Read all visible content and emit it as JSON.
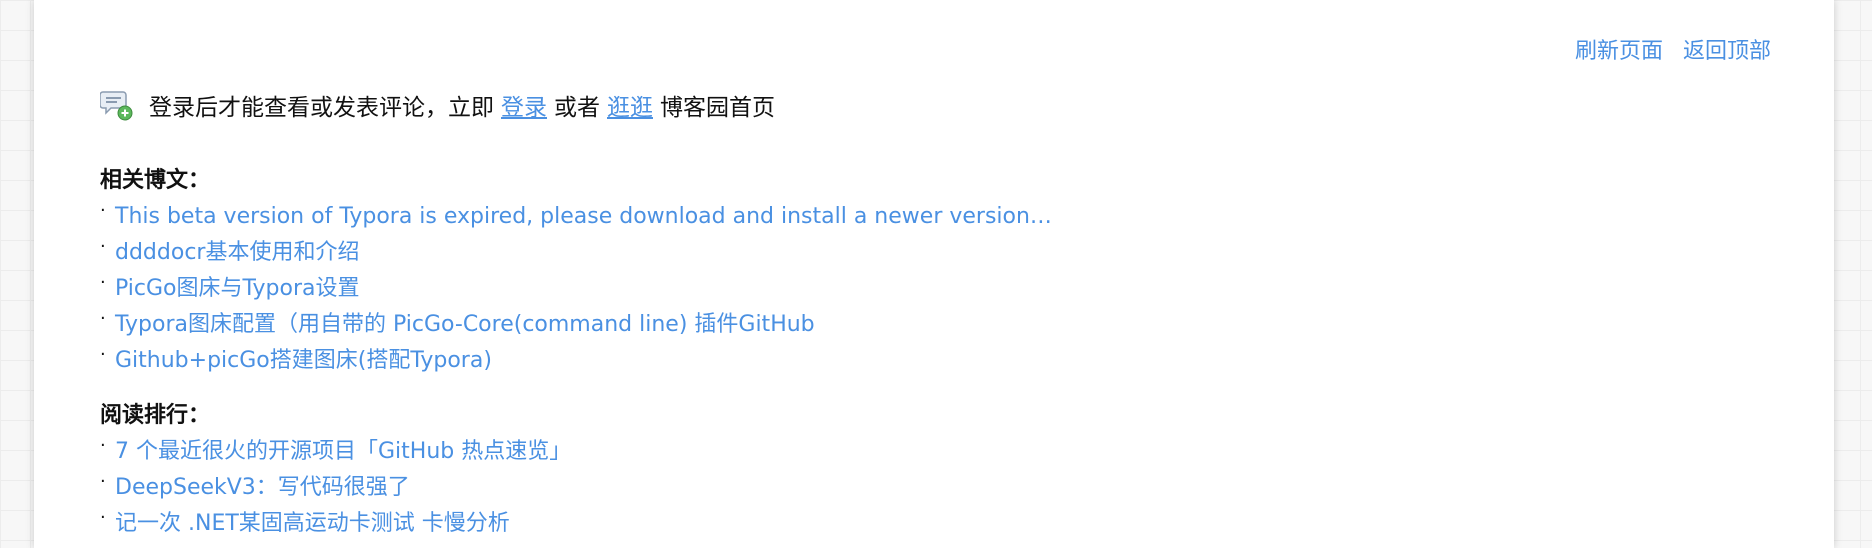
{
  "header": {
    "refresh_label": "刷新页面",
    "back_to_top_label": "返回顶部"
  },
  "comment_login": {
    "icon": "comment-add-icon",
    "prefix": "登录后才能查看或发表评论，立即",
    "login_link": "登录",
    "middle": "或者",
    "browse_link": "逛逛",
    "suffix": "博客园首页"
  },
  "related_posts": {
    "title": "相关博文：",
    "items": [
      "This beta version of Typora is expired, please download and install a newer version…",
      "ddddocr基本使用和介绍",
      "PicGo图床与Typora设置",
      "Typora图床配置（用自带的 PicGo-Core(command line) 插件GitHub",
      "Github+picGo搭建图床(搭配Typora)"
    ]
  },
  "reading_rank": {
    "title": "阅读排行：",
    "items": [
      "7 个最近很火的开源项目「GitHub 热点速览」",
      "DeepSeekV3：写代码很强了",
      "记一次 .NET某固高运动卡测试 卡慢分析"
    ]
  },
  "bullet": "·",
  "colors": {
    "link": "#4a90e2",
    "text": "#111111",
    "background": "#f7f7f7",
    "panel": "#ffffff"
  }
}
